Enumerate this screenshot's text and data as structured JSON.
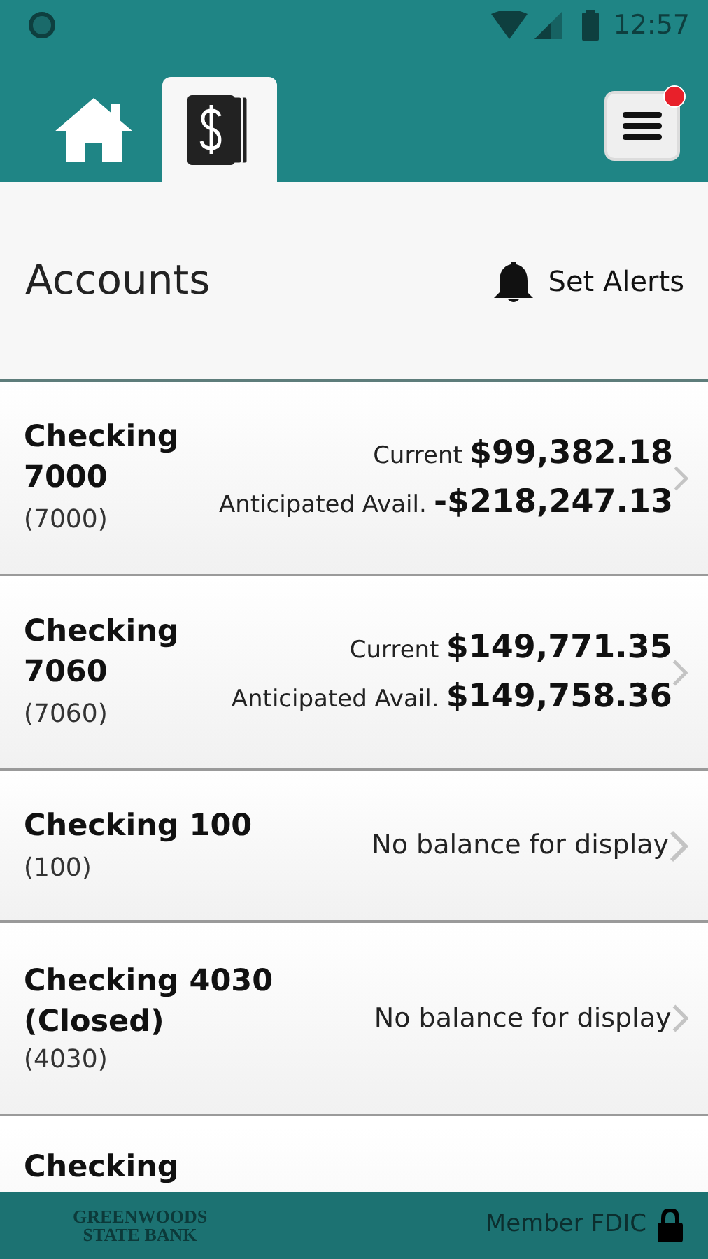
{
  "status_bar": {
    "time": "12:57"
  },
  "nav": {
    "tabs": [
      {
        "kind": "home",
        "selected": false
      },
      {
        "kind": "accounts",
        "selected": true
      }
    ],
    "menu": {
      "notification": true
    }
  },
  "header": {
    "title": "Accounts",
    "alerts_label": "Set Alerts"
  },
  "accounts": [
    {
      "kind": "balance",
      "name": "Checking 7000",
      "number": "(7000)",
      "current_label": "Current",
      "current": "$99,382.18",
      "anticipated_label": "Anticipated Avail.",
      "anticipated": "-$218,247.13"
    },
    {
      "kind": "balance",
      "name": "Checking 7060",
      "number": "(7060)",
      "current_label": "Current",
      "current": "$149,771.35",
      "anticipated_label": "Anticipated Avail.",
      "anticipated": "$149,758.36"
    },
    {
      "kind": "none",
      "name": "Checking 100",
      "number": "(100)",
      "message": "No balance for display"
    },
    {
      "kind": "none",
      "name": "Checking 4030 (Closed)",
      "number": "(4030)",
      "message": "No balance for display"
    },
    {
      "kind": "partial",
      "name": "Checking"
    }
  ],
  "footer": {
    "logo_lines": [
      "GREENWOODS",
      "STATE BANK"
    ],
    "fdic": "Member FDIC"
  }
}
